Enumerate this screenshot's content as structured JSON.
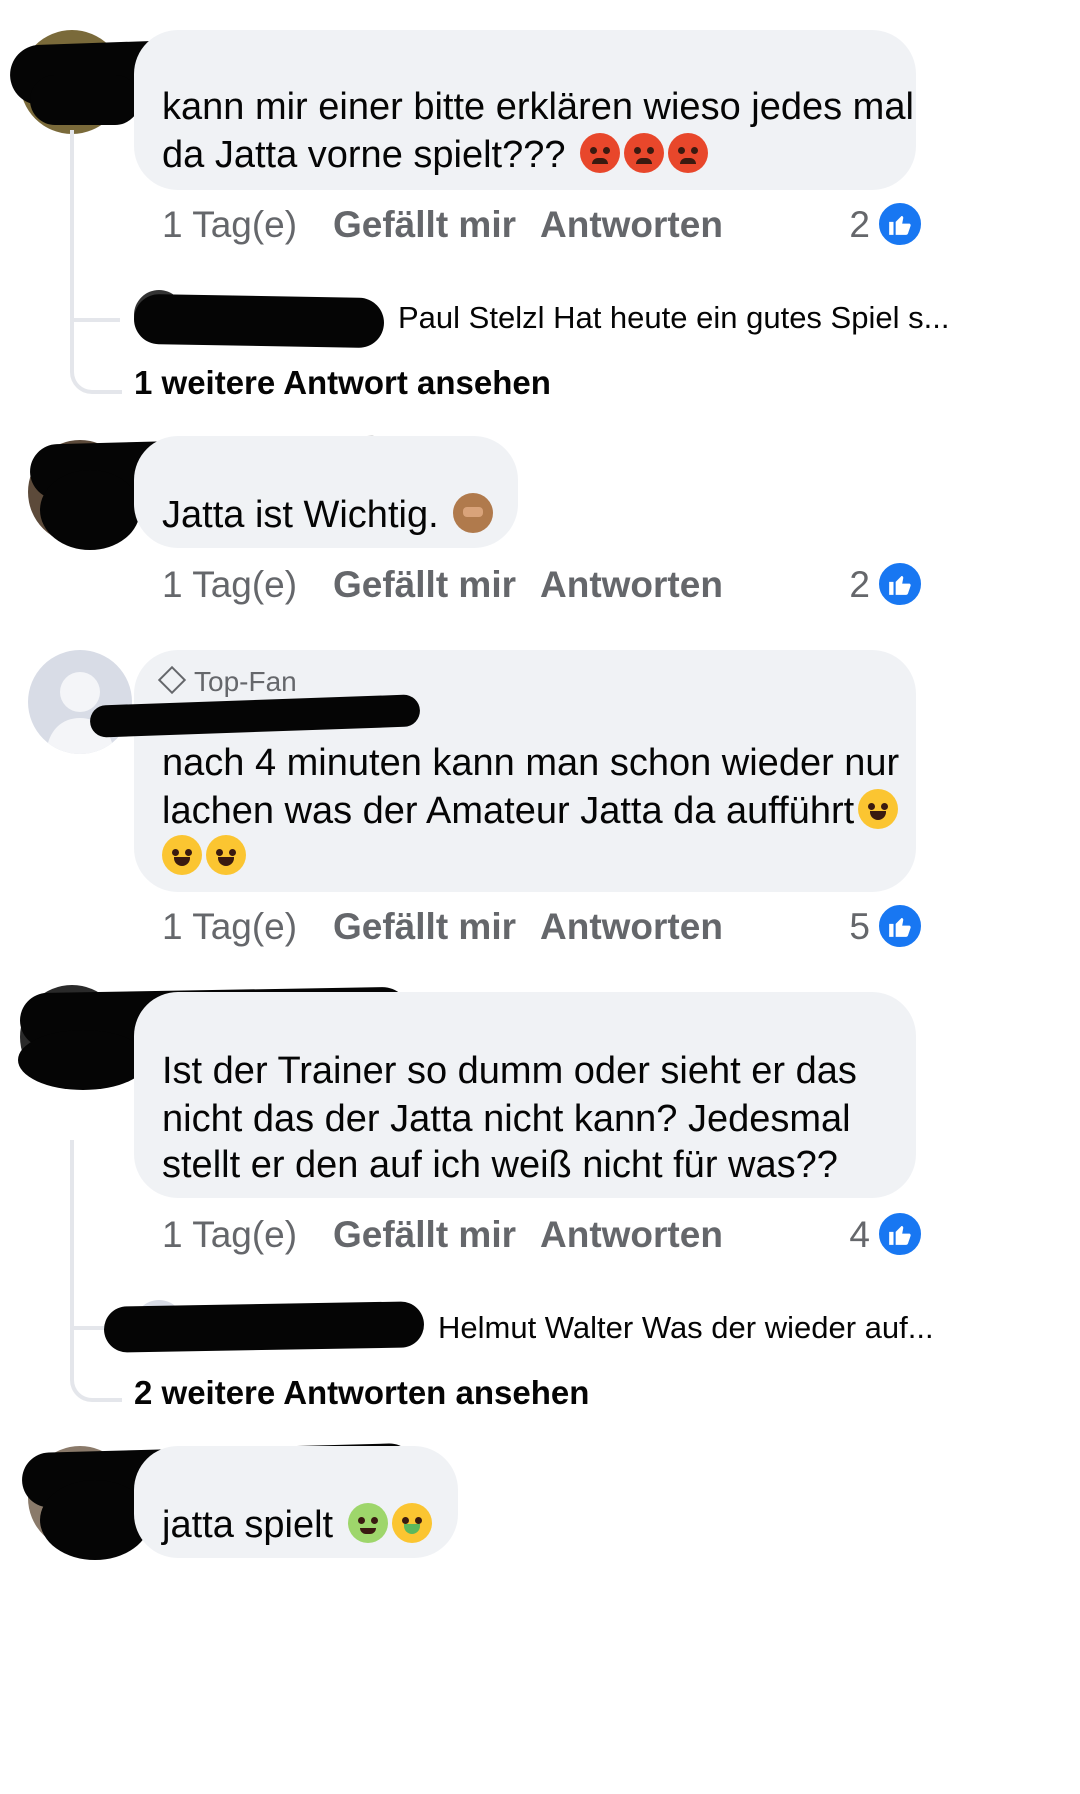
{
  "comments": [
    {
      "text_line1": "kann mir einer bitte erklären wieso jedes mal",
      "text_line2": "da Jatta vorne spielt???",
      "emojis": [
        "angry-face",
        "angry-face",
        "angry-face"
      ],
      "time": "1 Tag(e)",
      "like_label": "Gefällt mir",
      "reply_label": "Antworten",
      "like_count": "2",
      "reply_preview": "Paul Stelzl Hat heute ein gutes Spiel s...",
      "more_replies": "1 weitere Antwort ansehen"
    },
    {
      "text": "Jatta ist Wichtig.",
      "emojis": [
        "see-no-evil-monkey"
      ],
      "time": "1 Tag(e)",
      "like_label": "Gefällt mir",
      "reply_label": "Antworten",
      "like_count": "2"
    },
    {
      "badge": "Top-Fan",
      "text_line1": "nach 4 minuten kann man schon wieder nur",
      "text_line2": "lachen was der Amateur Jatta da aufführt",
      "emojis": [
        "tears-of-joy",
        "tears-of-joy",
        "tears-of-joy"
      ],
      "time": "1 Tag(e)",
      "like_label": "Gefällt mir",
      "reply_label": "Antworten",
      "like_count": "5"
    },
    {
      "text_line1": "Ist der Trainer so dumm oder sieht er das",
      "text_line2": "nicht das der Jatta nicht kann? Jedesmal",
      "text_line3": "stellt er den auf ich weiß nicht für was??",
      "time": "1 Tag(e)",
      "like_label": "Gefällt mir",
      "reply_label": "Antworten",
      "like_count": "4",
      "reply_preview": "Helmut Walter Was der wieder auf...",
      "more_replies": "2 weitere Antworten ansehen"
    },
    {
      "text": "jatta spielt",
      "emojis": [
        "nauseated-face",
        "vomiting-face"
      ]
    }
  ],
  "colors": {
    "bubble": "#f0f2f5",
    "meta": "#65676b",
    "like_badge": "#1877f2"
  }
}
